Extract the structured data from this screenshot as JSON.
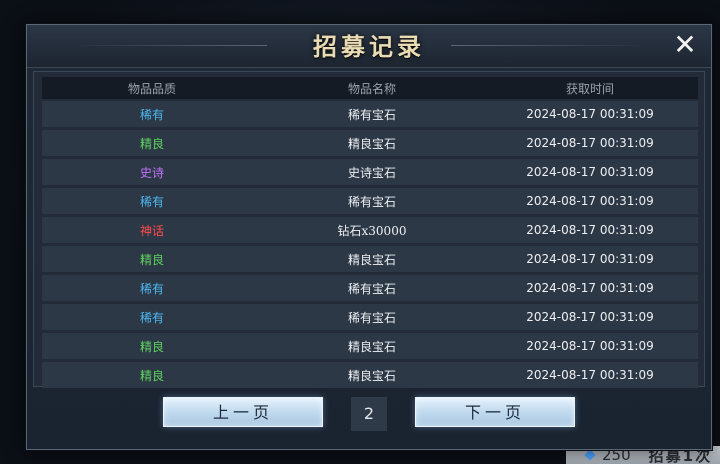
{
  "hud": {
    "value": "250",
    "label": "招募1次"
  },
  "dialog": {
    "title": "招募记录",
    "close_label": "✕"
  },
  "table": {
    "headers": [
      "物品品质",
      "物品名称",
      "获取时间"
    ],
    "rows": [
      {
        "quality": "稀有",
        "quality_class": "q-rare",
        "name": "稀有宝石",
        "time": "2024-08-17 00:31:09"
      },
      {
        "quality": "精良",
        "quality_class": "q-good",
        "name": "精良宝石",
        "time": "2024-08-17 00:31:09"
      },
      {
        "quality": "史诗",
        "quality_class": "q-epic",
        "name": "史诗宝石",
        "time": "2024-08-17 00:31:09"
      },
      {
        "quality": "稀有",
        "quality_class": "q-rare",
        "name": "稀有宝石",
        "time": "2024-08-17 00:31:09"
      },
      {
        "quality": "神话",
        "quality_class": "q-myth",
        "name": "钻石x30000",
        "time": "2024-08-17 00:31:09"
      },
      {
        "quality": "精良",
        "quality_class": "q-good",
        "name": "精良宝石",
        "time": "2024-08-17 00:31:09"
      },
      {
        "quality": "稀有",
        "quality_class": "q-rare",
        "name": "稀有宝石",
        "time": "2024-08-17 00:31:09"
      },
      {
        "quality": "稀有",
        "quality_class": "q-rare",
        "name": "稀有宝石",
        "time": "2024-08-17 00:31:09"
      },
      {
        "quality": "精良",
        "quality_class": "q-good",
        "name": "精良宝石",
        "time": "2024-08-17 00:31:09"
      },
      {
        "quality": "精良",
        "quality_class": "q-good",
        "name": "精良宝石",
        "time": "2024-08-17 00:31:09"
      }
    ]
  },
  "pagination": {
    "prev_label": "上一页",
    "page": "2",
    "next_label": "下一页"
  },
  "colors": {
    "rare": "#4cb8f2",
    "good": "#5fd35f",
    "epic": "#c172ff",
    "myth": "#ff4a4a",
    "title": "#e9dcb4"
  }
}
